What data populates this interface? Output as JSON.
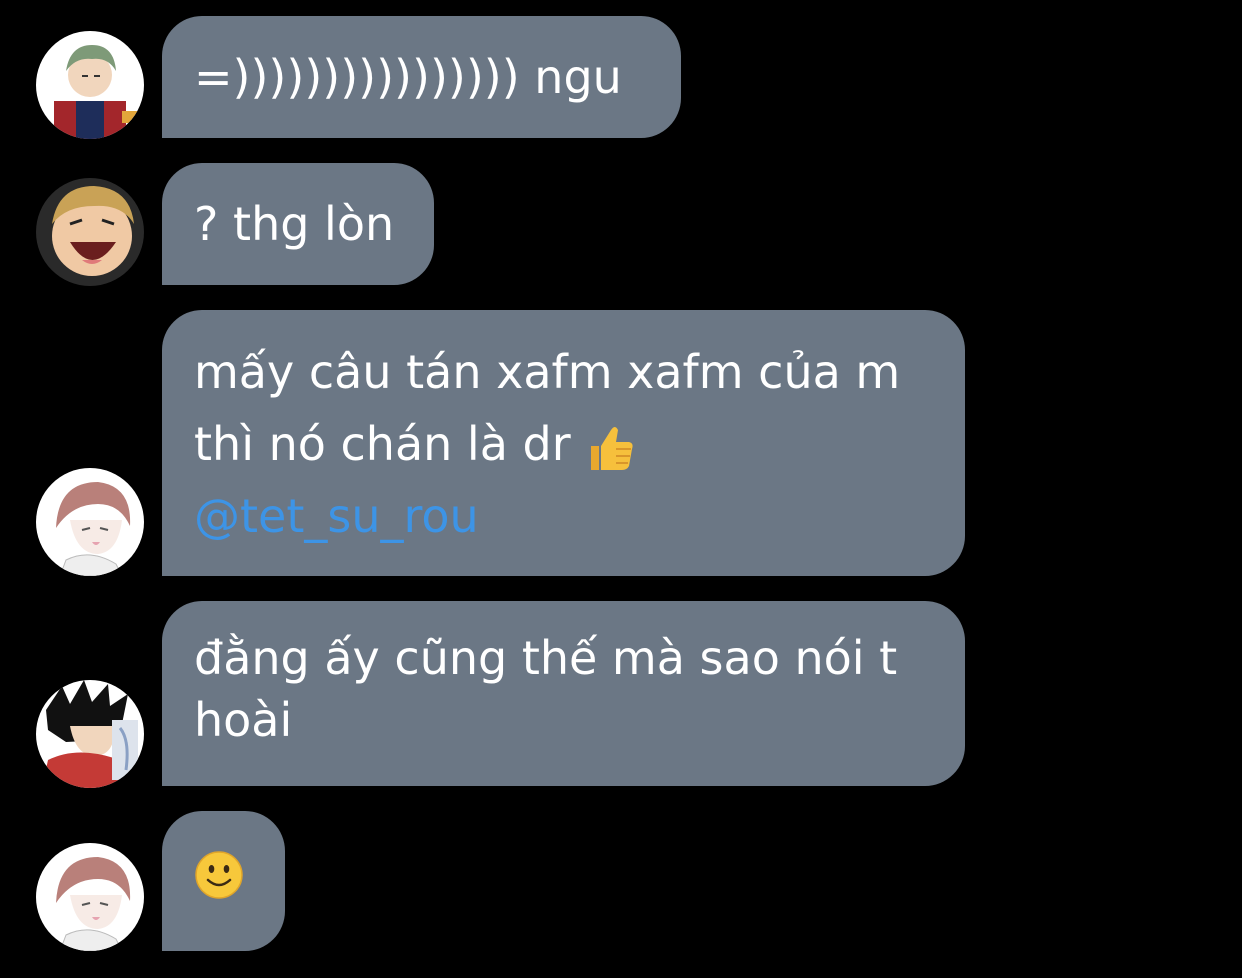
{
  "messages": [
    {
      "avatar": "green-haired-character-avatar",
      "lines": [
        "=)))))))))))))))) ngu"
      ]
    },
    {
      "avatar": "laughing-blond-character-avatar",
      "lines": [
        "? thg lòn"
      ]
    },
    {
      "avatar": "brown-haired-character-avatar",
      "lines": [
        "mấy câu tán xafm xafm của m",
        "thì nó chán là dr"
      ],
      "emoji": "thumbs-up-icon",
      "mention": "@tet_su_rou"
    },
    {
      "avatar": "black-haired-character-avatar",
      "lines": [
        "đằng ấy cũng thế mà sao nói t",
        "hoài"
      ]
    },
    {
      "avatar": "brown-haired-character-avatar",
      "emoji": "slightly-smiling-face-icon"
    }
  ],
  "colors": {
    "background": "#000000",
    "bubble": "#6b7785",
    "text": "#ffffff",
    "mention": "#3d94e6"
  }
}
